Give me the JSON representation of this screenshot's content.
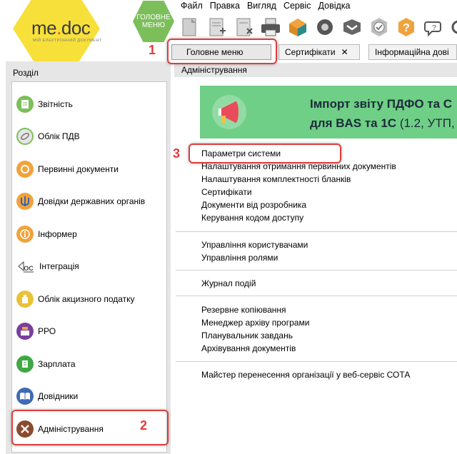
{
  "logo": {
    "brand_me": "me",
    "brand_dot": ".",
    "brand_doc": "doc",
    "tagline": "МІЙ ЕЛЕКТРОННИЙ ДОКУМЕНТ"
  },
  "main_menu_button": {
    "line1": "ГОЛОВНЕ",
    "line2": "МЕНЮ"
  },
  "menubar": [
    "Файл",
    "Правка",
    "Вигляд",
    "Сервіс",
    "Довідка"
  ],
  "toolbar_icons": [
    "new-doc-icon",
    "add-doc-icon",
    "delete-doc-icon",
    "print-icon",
    "send-icon",
    "seal-icon",
    "receive-icon",
    "check-icon",
    "help-icon",
    "chat-icon",
    "settings-icon"
  ],
  "tabs": [
    {
      "label": "Головне меню"
    },
    {
      "label": "Сертифікати",
      "close": "✕"
    },
    {
      "label": "Інформаційна дові"
    }
  ],
  "sidebar": {
    "header": "Розділ",
    "items": [
      {
        "label": "Звітність",
        "icon": "report-icon",
        "color": "#7cbf5a"
      },
      {
        "label": "Облік ПДВ",
        "icon": "vat-icon",
        "color": "#7cbf5a"
      },
      {
        "label": "Первинні документи",
        "icon": "primary-docs-icon",
        "color": "#f0a33c"
      },
      {
        "label": "Довідки державних органів",
        "icon": "trident-icon",
        "color": "#f0a33c"
      },
      {
        "label": "Інформер",
        "icon": "info-icon",
        "color": "#f0a33c"
      },
      {
        "label": "Інтеграція",
        "icon": "integration-icon",
        "color": "#ffffff"
      },
      {
        "label": "Облік акцизного податку",
        "icon": "excise-icon",
        "color": "#e9c23a"
      },
      {
        "label": "РРО",
        "icon": "cash-register-icon",
        "color": "#7a3f9c"
      },
      {
        "label": "Зарплата",
        "icon": "salary-icon",
        "color": "#3fa845"
      },
      {
        "label": "Довідники",
        "icon": "book-icon",
        "color": "#3f6ab8"
      },
      {
        "label": "Адміністрування",
        "icon": "admin-tools-icon",
        "color": "#8b4a2f"
      }
    ]
  },
  "content": {
    "title": "Адміністрування",
    "banner": {
      "line1": "Імпорт звіту ПДФО та С",
      "line2_bold": "для BAS та 1С",
      "line2_rest": " (1.2, УТП,"
    },
    "groups": [
      [
        "Параметри системи",
        "Налаштування отримання первинних документів",
        "Налаштування комплектності бланків",
        "Сертифікати",
        "Документи від розробника",
        "Керування кодом доступу"
      ],
      [
        "Управління користувачами",
        "Управління ролями"
      ],
      [
        "Журнал подій"
      ],
      [
        "Резервне копіювання",
        "Менеджер архіву програми",
        "Планувальник завдань",
        "Архівування документів"
      ],
      [
        "Майстер перенесення організації у веб-сервіс СОТА"
      ]
    ]
  },
  "annotations": {
    "n1": "1",
    "n2": "2",
    "n3": "3"
  },
  "colors": {
    "accent_red": "#e23c3c",
    "menu_green": "#7cbf5a",
    "banner_green": "#6fcf86",
    "logo_yellow": "#f8e03a"
  }
}
